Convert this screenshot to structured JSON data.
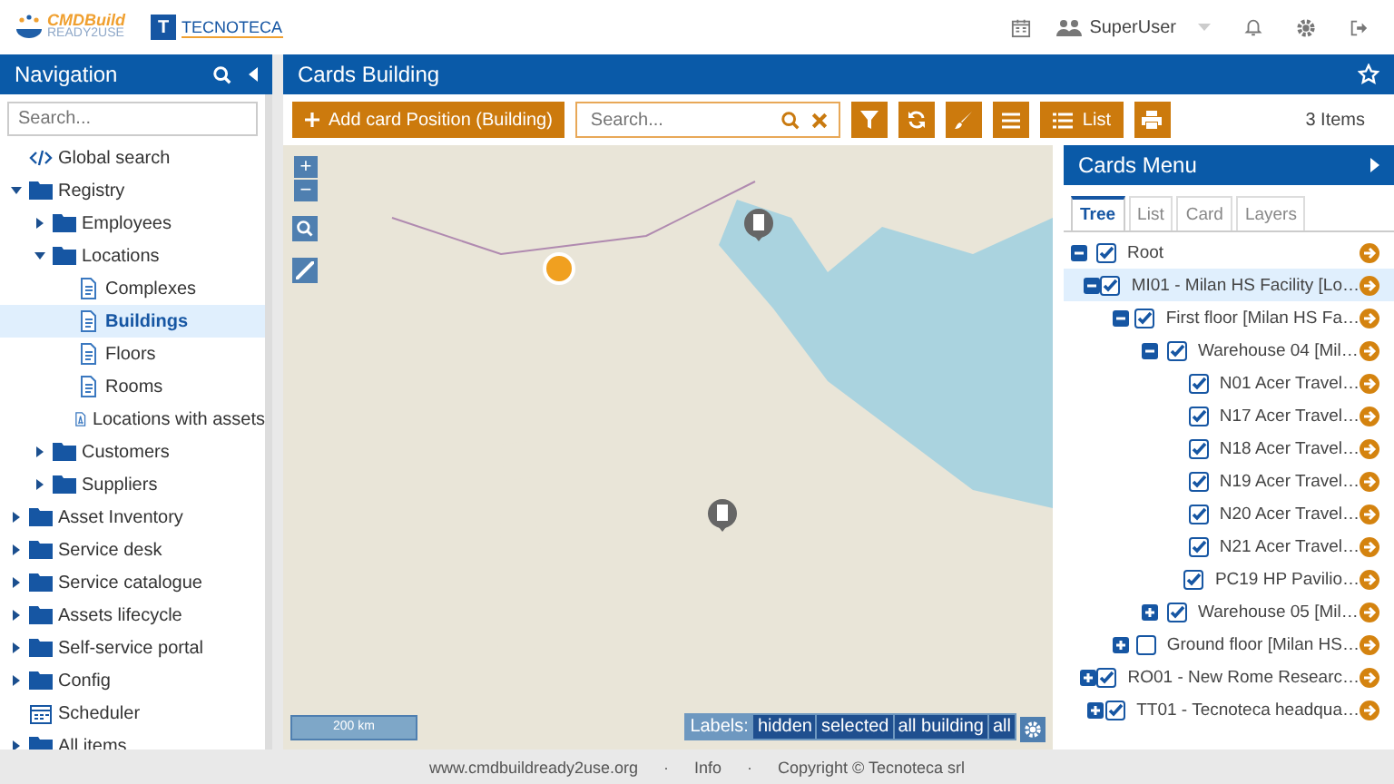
{
  "header": {
    "logo_primary": "CMDBuild",
    "partner_logo_mark": "T",
    "logo_secondary": "READY2USE",
    "partner_logo": "TECNOTECA",
    "user": "SuperUser"
  },
  "navigation": {
    "title": "Navigation",
    "search": {
      "placeholder": "Search..."
    },
    "items": [
      {
        "label": "Global search",
        "kind": "search",
        "selected": false
      },
      {
        "label": "Registry",
        "kind": "folder",
        "expanded": true,
        "selected": false,
        "children": [
          {
            "label": "Employees",
            "kind": "folder",
            "expanded": false,
            "selected": false
          },
          {
            "label": "Locations",
            "kind": "folder",
            "expanded": true,
            "selected": false,
            "children": [
              {
                "label": "Complexes",
                "kind": "class",
                "selected": false
              },
              {
                "label": "Buildings",
                "kind": "class",
                "selected": true
              },
              {
                "label": "Floors",
                "kind": "class",
                "selected": false
              },
              {
                "label": "Rooms",
                "kind": "class",
                "selected": false
              },
              {
                "label": "Locations with assets",
                "kind": "report",
                "selected": false
              }
            ]
          },
          {
            "label": "Customers",
            "kind": "folder",
            "expanded": false,
            "selected": false
          },
          {
            "label": "Suppliers",
            "kind": "folder",
            "expanded": false,
            "selected": false
          }
        ]
      },
      {
        "label": "Asset Inventory",
        "kind": "folder",
        "expanded": false,
        "selected": false
      },
      {
        "label": "Service desk",
        "kind": "folder",
        "expanded": false,
        "selected": false
      },
      {
        "label": "Service catalogue",
        "kind": "folder",
        "expanded": false,
        "selected": false
      },
      {
        "label": "Assets lifecycle",
        "kind": "folder",
        "expanded": false,
        "selected": false
      },
      {
        "label": "Self-service portal",
        "kind": "folder",
        "expanded": false,
        "selected": false
      },
      {
        "label": "Config",
        "kind": "folder",
        "expanded": false,
        "selected": false
      },
      {
        "label": "Scheduler",
        "kind": "scheduler",
        "selected": false
      },
      {
        "label": "All items",
        "kind": "folder",
        "expanded": false,
        "selected": false
      }
    ]
  },
  "main": {
    "title": "Cards Building",
    "add_button": "Add card Position (Building)",
    "search": {
      "placeholder": "Search..."
    },
    "list_button": "List",
    "items_count": "3 Items"
  },
  "map": {
    "zoom_in": "+",
    "zoom_out": "−",
    "scale": "200 km",
    "labels_title": "Labels:",
    "label_options": [
      {
        "label": "hidden",
        "selected": false
      },
      {
        "label": "selected",
        "selected": false
      },
      {
        "label": "all building",
        "selected": false
      },
      {
        "label": "all",
        "selected": false
      }
    ]
  },
  "cards_menu": {
    "title": "Cards Menu",
    "tabs": [
      {
        "label": "Tree",
        "selected": true
      },
      {
        "label": "List",
        "selected": false
      },
      {
        "label": "Card",
        "selected": false
      },
      {
        "label": "Layers",
        "selected": false
      }
    ],
    "tree": [
      {
        "label": "Root",
        "checked": true,
        "expanded": true,
        "selected": false,
        "children": [
          {
            "label": "MI01 - Milan HS Facility [Lo…",
            "checked": true,
            "expanded": true,
            "selected": true,
            "children": [
              {
                "label": "First floor [Milan HS Fa…",
                "checked": true,
                "expanded": true,
                "selected": false,
                "children": [
                  {
                    "label": "Warehouse 04 [Mil…",
                    "checked": true,
                    "expanded": true,
                    "selected": false,
                    "children": [
                      {
                        "label": "N01 Acer Travel…",
                        "checked": true,
                        "selected": false
                      },
                      {
                        "label": "N17 Acer Travel…",
                        "checked": true,
                        "selected": false
                      },
                      {
                        "label": "N18 Acer Travel…",
                        "checked": true,
                        "selected": false
                      },
                      {
                        "label": "N19 Acer Travel…",
                        "checked": true,
                        "selected": false
                      },
                      {
                        "label": "N20 Acer Travel…",
                        "checked": true,
                        "selected": false
                      },
                      {
                        "label": "N21 Acer Travel…",
                        "checked": true,
                        "selected": false
                      },
                      {
                        "label": "PC19 HP Pavilio…",
                        "checked": true,
                        "selected": false
                      }
                    ]
                  },
                  {
                    "label": "Warehouse 05 [Mil…",
                    "checked": true,
                    "expanded": false,
                    "selected": false
                  }
                ]
              },
              {
                "label": "Ground floor [Milan HS…",
                "checked": false,
                "expanded": false,
                "selected": false
              }
            ]
          },
          {
            "label": "RO01 - New Rome Researc…",
            "checked": true,
            "expanded": false,
            "selected": false
          },
          {
            "label": "TT01 - Tecnoteca headqua…",
            "checked": true,
            "expanded": false,
            "selected": false
          }
        ]
      }
    ]
  },
  "footer": {
    "website": "www.cmdbuildready2use.org",
    "separator_1": "·",
    "info": "Info",
    "separator_2": "·",
    "copyright": "Copyright © Tecnoteca srl"
  }
}
